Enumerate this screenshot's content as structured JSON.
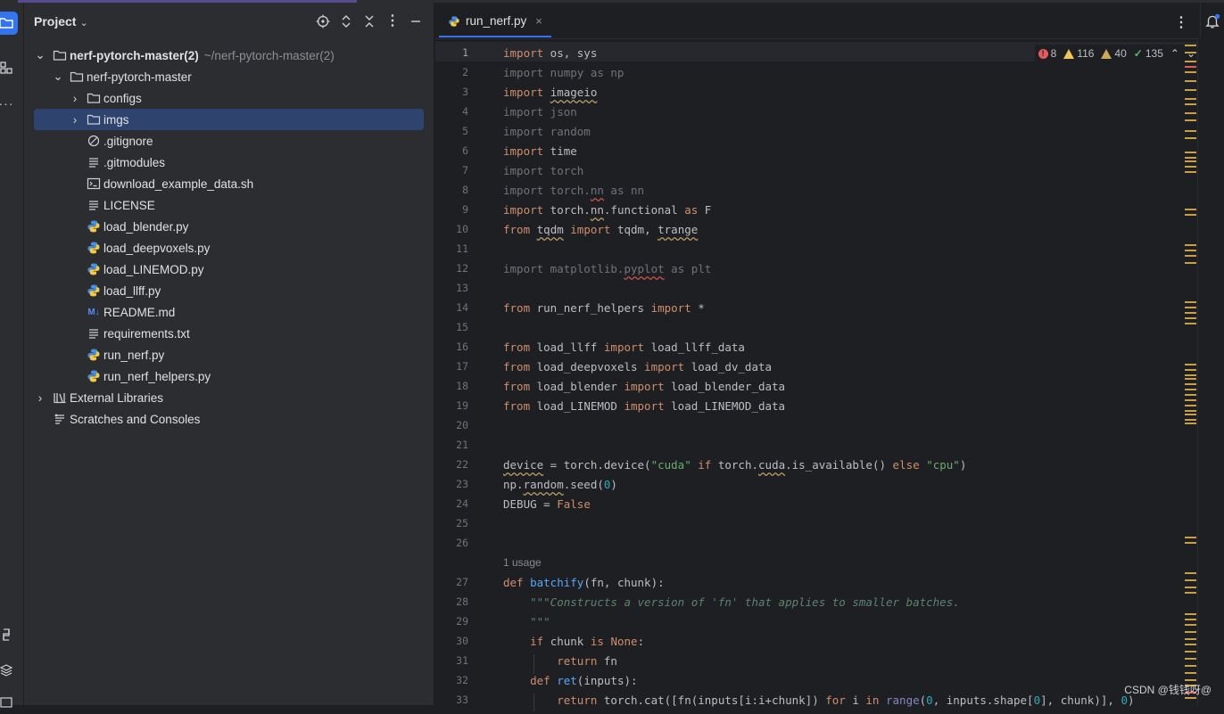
{
  "panel": {
    "title": "Project",
    "tree": [
      {
        "label": "nerf-pytorch-master(2)",
        "path": "~/nerf-pytorch-master(2)",
        "kind": "folder",
        "level": 0,
        "expanded": true,
        "bold": true
      },
      {
        "label": "nerf-pytorch-master",
        "kind": "folder",
        "level": 1,
        "expanded": true
      },
      {
        "label": "configs",
        "kind": "folder",
        "level": 2,
        "expanded": false
      },
      {
        "label": "imgs",
        "kind": "folder",
        "level": 2,
        "expanded": false,
        "selected": true
      },
      {
        "label": ".gitignore",
        "kind": "ignore",
        "level": 2
      },
      {
        "label": ".gitmodules",
        "kind": "text",
        "level": 2
      },
      {
        "label": "download_example_data.sh",
        "kind": "shell",
        "level": 2
      },
      {
        "label": "LICENSE",
        "kind": "text",
        "level": 2
      },
      {
        "label": "load_blender.py",
        "kind": "python",
        "level": 2
      },
      {
        "label": "load_deepvoxels.py",
        "kind": "python",
        "level": 2
      },
      {
        "label": "load_LINEMOD.py",
        "kind": "python",
        "level": 2
      },
      {
        "label": "load_llff.py",
        "kind": "python",
        "level": 2
      },
      {
        "label": "README.md",
        "kind": "markdown",
        "level": 2
      },
      {
        "label": "requirements.txt",
        "kind": "text",
        "level": 2
      },
      {
        "label": "run_nerf.py",
        "kind": "python",
        "level": 2
      },
      {
        "label": "run_nerf_helpers.py",
        "kind": "python",
        "level": 2
      },
      {
        "label": "External Libraries",
        "kind": "library",
        "level": 0,
        "expanded": false
      },
      {
        "label": "Scratches and Consoles",
        "kind": "scratches",
        "level": 0
      }
    ]
  },
  "editor": {
    "tab_label": "run_nerf.py",
    "tab_close": "×",
    "inspections": {
      "errors": "8",
      "warnings": "116",
      "weak_warnings": "40",
      "typos": "135"
    },
    "line_numbers": [
      "1",
      "2",
      "3",
      "4",
      "5",
      "6",
      "7",
      "8",
      "9",
      "10",
      "11",
      "12",
      "13",
      "14",
      "15",
      "16",
      "17",
      "18",
      "19",
      "20",
      "21",
      "22",
      "23",
      "24",
      "25",
      "26",
      "27",
      "28",
      "29",
      "30",
      "31",
      "32",
      "33"
    ],
    "usage_hint": "1 usage",
    "lines": [
      "import os, sys",
      "import numpy as np",
      "import imageio",
      "import json",
      "import random",
      "import time",
      "import torch",
      "import torch.nn as nn",
      "import torch.nn.functional as F",
      "from tqdm import tqdm, trange",
      "",
      "import matplotlib.pyplot as plt",
      "",
      "from run_nerf_helpers import *",
      "",
      "from load_llff import load_llff_data",
      "from load_deepvoxels import load_dv_data",
      "from load_blender import load_blender_data",
      "from load_LINEMOD import load_LINEMOD_data",
      "",
      "",
      "device = torch.device(\"cuda\" if torch.cuda.is_available() else \"cpu\")",
      "np.random.seed(0)",
      "DEBUG = False",
      "",
      "",
      "def batchify(fn, chunk):",
      "    \"\"\"Constructs a version of 'fn' that applies to smaller batches.",
      "    \"\"\"",
      "    if chunk is None:",
      "        return fn",
      "    def ret(inputs):",
      "        return torch.cat([fn(inputs[i:i+chunk]) for i in range(0, inputs.shape[0], chunk)], 0)"
    ]
  },
  "watermark": "CSDN @钱钱呀@",
  "colors": {
    "accent": "#3574f0",
    "selection": "#2e436e",
    "keyword": "#cf8e6d",
    "string": "#6aab73",
    "number": "#2aacb8",
    "function": "#56a8f5"
  }
}
